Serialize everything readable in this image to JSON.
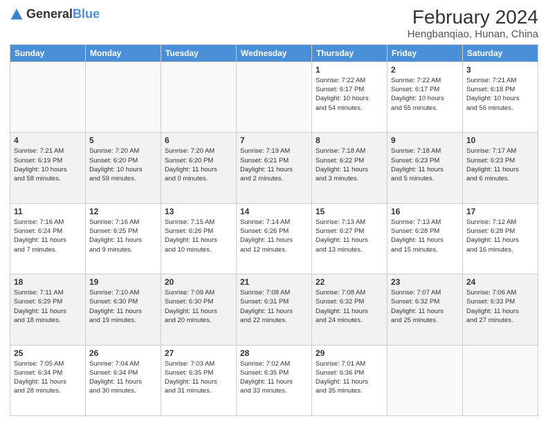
{
  "logo": {
    "text_general": "General",
    "text_blue": "Blue"
  },
  "title": {
    "month_year": "February 2024",
    "location": "Hengbanqiao, Hunan, China"
  },
  "headers": [
    "Sunday",
    "Monday",
    "Tuesday",
    "Wednesday",
    "Thursday",
    "Friday",
    "Saturday"
  ],
  "weeks": [
    [
      {
        "day": "",
        "info": ""
      },
      {
        "day": "",
        "info": ""
      },
      {
        "day": "",
        "info": ""
      },
      {
        "day": "",
        "info": ""
      },
      {
        "day": "1",
        "info": "Sunrise: 7:22 AM\nSunset: 6:17 PM\nDaylight: 10 hours\nand 54 minutes."
      },
      {
        "day": "2",
        "info": "Sunrise: 7:22 AM\nSunset: 6:17 PM\nDaylight: 10 hours\nand 55 minutes."
      },
      {
        "day": "3",
        "info": "Sunrise: 7:21 AM\nSunset: 6:18 PM\nDaylight: 10 hours\nand 56 minutes."
      }
    ],
    [
      {
        "day": "4",
        "info": "Sunrise: 7:21 AM\nSunset: 6:19 PM\nDaylight: 10 hours\nand 58 minutes."
      },
      {
        "day": "5",
        "info": "Sunrise: 7:20 AM\nSunset: 6:20 PM\nDaylight: 10 hours\nand 59 minutes."
      },
      {
        "day": "6",
        "info": "Sunrise: 7:20 AM\nSunset: 6:20 PM\nDaylight: 11 hours\nand 0 minutes."
      },
      {
        "day": "7",
        "info": "Sunrise: 7:19 AM\nSunset: 6:21 PM\nDaylight: 11 hours\nand 2 minutes."
      },
      {
        "day": "8",
        "info": "Sunrise: 7:18 AM\nSunset: 6:22 PM\nDaylight: 11 hours\nand 3 minutes."
      },
      {
        "day": "9",
        "info": "Sunrise: 7:18 AM\nSunset: 6:23 PM\nDaylight: 11 hours\nand 5 minutes."
      },
      {
        "day": "10",
        "info": "Sunrise: 7:17 AM\nSunset: 6:23 PM\nDaylight: 11 hours\nand 6 minutes."
      }
    ],
    [
      {
        "day": "11",
        "info": "Sunrise: 7:16 AM\nSunset: 6:24 PM\nDaylight: 11 hours\nand 7 minutes."
      },
      {
        "day": "12",
        "info": "Sunrise: 7:16 AM\nSunset: 6:25 PM\nDaylight: 11 hours\nand 9 minutes."
      },
      {
        "day": "13",
        "info": "Sunrise: 7:15 AM\nSunset: 6:26 PM\nDaylight: 11 hours\nand 10 minutes."
      },
      {
        "day": "14",
        "info": "Sunrise: 7:14 AM\nSunset: 6:26 PM\nDaylight: 11 hours\nand 12 minutes."
      },
      {
        "day": "15",
        "info": "Sunrise: 7:13 AM\nSunset: 6:27 PM\nDaylight: 11 hours\nand 13 minutes."
      },
      {
        "day": "16",
        "info": "Sunrise: 7:13 AM\nSunset: 6:28 PM\nDaylight: 11 hours\nand 15 minutes."
      },
      {
        "day": "17",
        "info": "Sunrise: 7:12 AM\nSunset: 6:28 PM\nDaylight: 11 hours\nand 16 minutes."
      }
    ],
    [
      {
        "day": "18",
        "info": "Sunrise: 7:11 AM\nSunset: 6:29 PM\nDaylight: 11 hours\nand 18 minutes."
      },
      {
        "day": "19",
        "info": "Sunrise: 7:10 AM\nSunset: 6:30 PM\nDaylight: 11 hours\nand 19 minutes."
      },
      {
        "day": "20",
        "info": "Sunrise: 7:09 AM\nSunset: 6:30 PM\nDaylight: 11 hours\nand 20 minutes."
      },
      {
        "day": "21",
        "info": "Sunrise: 7:08 AM\nSunset: 6:31 PM\nDaylight: 11 hours\nand 22 minutes."
      },
      {
        "day": "22",
        "info": "Sunrise: 7:08 AM\nSunset: 6:32 PM\nDaylight: 11 hours\nand 24 minutes."
      },
      {
        "day": "23",
        "info": "Sunrise: 7:07 AM\nSunset: 6:32 PM\nDaylight: 11 hours\nand 25 minutes."
      },
      {
        "day": "24",
        "info": "Sunrise: 7:06 AM\nSunset: 6:33 PM\nDaylight: 11 hours\nand 27 minutes."
      }
    ],
    [
      {
        "day": "25",
        "info": "Sunrise: 7:05 AM\nSunset: 6:34 PM\nDaylight: 11 hours\nand 28 minutes."
      },
      {
        "day": "26",
        "info": "Sunrise: 7:04 AM\nSunset: 6:34 PM\nDaylight: 11 hours\nand 30 minutes."
      },
      {
        "day": "27",
        "info": "Sunrise: 7:03 AM\nSunset: 6:35 PM\nDaylight: 11 hours\nand 31 minutes."
      },
      {
        "day": "28",
        "info": "Sunrise: 7:02 AM\nSunset: 6:35 PM\nDaylight: 11 hours\nand 33 minutes."
      },
      {
        "day": "29",
        "info": "Sunrise: 7:01 AM\nSunset: 6:36 PM\nDaylight: 11 hours\nand 35 minutes."
      },
      {
        "day": "",
        "info": ""
      },
      {
        "day": "",
        "info": ""
      }
    ]
  ]
}
